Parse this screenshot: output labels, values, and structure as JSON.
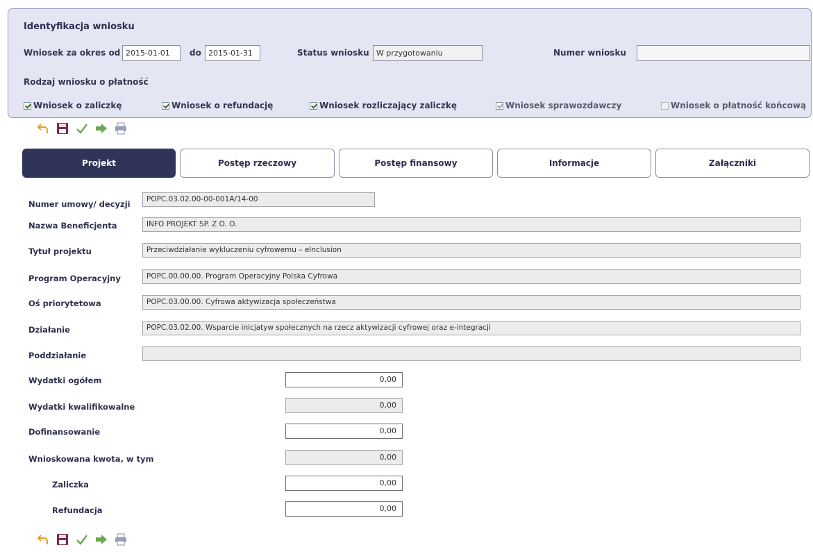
{
  "header": {
    "title": "Identyfikacja wniosku",
    "period_from_label": "Wniosek za okres od",
    "period_from_value": "2015-01-01",
    "period_to_label": "do",
    "period_to_value": "2015-01-31",
    "status_label": "Status wniosku",
    "status_value": "W przygotowaniu",
    "number_label": "Numer wniosku",
    "number_value": "",
    "type_label": "Rodzaj wniosku o płatność",
    "checkboxes": [
      {
        "label": "Wniosek o zaliczkę",
        "checked": true
      },
      {
        "label": "Wniosek o refundację",
        "checked": true
      },
      {
        "label": "Wniosek rozliczający zaliczkę",
        "checked": true
      },
      {
        "label": "Wniosek sprawozdawczy",
        "checked": true
      },
      {
        "label": "Wniosek o płatność końcową",
        "checked": false
      }
    ]
  },
  "toolbar_icons": [
    "undo-icon",
    "save-icon",
    "check-icon",
    "forward-icon",
    "print-icon"
  ],
  "tabs": [
    {
      "label": "Projekt",
      "active": true
    },
    {
      "label": "Postęp rzeczowy",
      "active": false
    },
    {
      "label": "Postęp finansowy",
      "active": false
    },
    {
      "label": "Informacje",
      "active": false
    },
    {
      "label": "Załączniki",
      "active": false
    }
  ],
  "project": {
    "umowa_label": "Numer umowy/ decyzji",
    "umowa_value": "POPC.03.02.00-00-001A/14-00",
    "beneficjent_label": "Nazwa Beneficjenta",
    "beneficjent_value": "INFO PROJEKT SP. Z O. O.",
    "tytul_label": "Tytuł projektu",
    "tytul_value": "Przeciwdziałanie wykluczeniu cyfrowemu – eInclusion",
    "program_label": "Program Operacyjny",
    "program_value": "POPC.00.00.00. Program Operacyjny Polska Cyfrowa",
    "os_label": "Oś priorytetowa",
    "os_value": "POPC.03.00.00. Cyfrowa aktywizacja społeczeństwa",
    "dzialanie_label": "Działanie",
    "dzialanie_value": "POPC.03.02.00. Wsparcie inicjatyw społecznych na rzecz aktywizacji cyfrowej oraz e-integracji",
    "poddzialanie_label": "Poddziałanie",
    "poddzialanie_value": ""
  },
  "amounts": {
    "ogolem_label": "Wydatki ogółem",
    "ogolem_value": "0,00",
    "kwalifikowalne_label": "Wydatki kwalifikowalne",
    "kwalifikowalne_value": "0,00",
    "dofinansowanie_label": "Dofinansowanie",
    "dofinansowanie_value": "0,00",
    "wnioskowana_label": "Wnioskowana kwota, w tym",
    "wnioskowana_value": "0,00",
    "zaliczka_label": "Zaliczka",
    "zaliczka_value": "0,00",
    "refundacja_label": "Refundacja",
    "refundacja_value": "0,00"
  }
}
